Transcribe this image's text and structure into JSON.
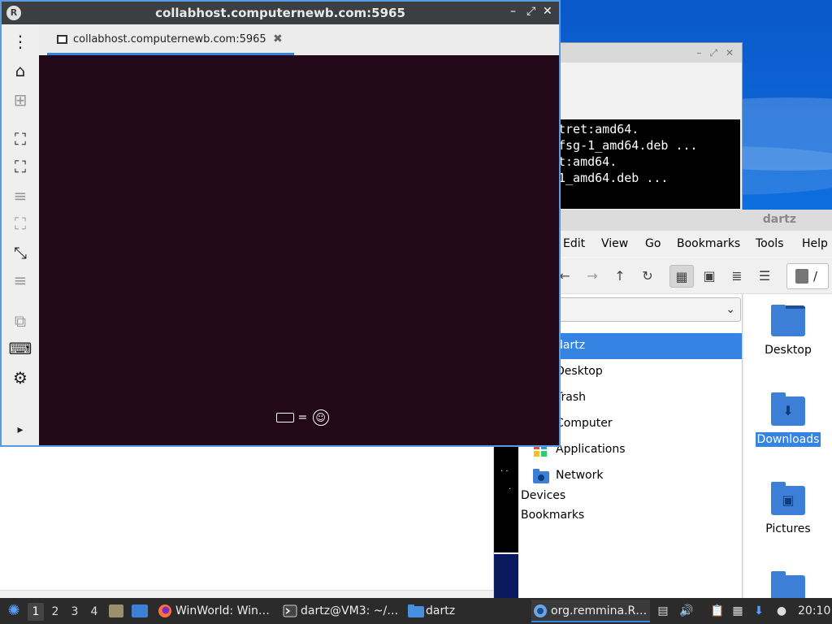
{
  "remmina": {
    "title": "collabhost.computernewb.com:5965",
    "tab_label": "collabhost.computernewb.com:5965",
    "tab_close": "✖",
    "controls": {
      "minimize": "–",
      "maximize": "⤢",
      "close": "✕"
    },
    "logo": "R",
    "sidebar": [
      "more-menu",
      "home",
      "new-connection",
      "fit-window",
      "fullscreen",
      "drag-handle",
      "dynamic-resolution",
      "scale",
      "drag-handle-2",
      "multi-monitor",
      "keyboard",
      "preferences",
      "expand"
    ],
    "sidebar_glyphs": [
      "⋮",
      "⌂",
      "⊞",
      "⛶",
      "⛶",
      "≡",
      "⛶",
      "⤡",
      "≡",
      "⧉",
      "⌨",
      "⚙",
      "▸"
    ],
    "indicator": {
      "eq": "=",
      "acc_glyph": "☺"
    }
  },
  "terminal": {
    "title_controls": [
      "–",
      "⤢",
      "✕"
    ],
    "lines": [
      "tret:amd64.",
      "fsg-1_amd64.deb ...",
      "",
      "t:amd64.",
      "1_amd64.deb ..."
    ]
  },
  "black_strip": {
    "dots_1": ". .",
    "dots_2": "."
  },
  "file_manager": {
    "title": "dartz",
    "menu": [
      "Edit",
      "View",
      "Go",
      "Bookmarks",
      "Tools",
      "Help"
    ],
    "toolbar": {
      "back": "←",
      "forward": "→",
      "up": "↑",
      "reload": "↻",
      "icon_view": "▦",
      "thumb_view": "▣",
      "compact_view": "≣",
      "list_view": "☰",
      "path": "/"
    },
    "select_chevron": "⌄",
    "places": [
      {
        "label": "dartz",
        "selected": true
      },
      {
        "label": "Desktop",
        "selected": false
      },
      {
        "label": "Trash",
        "selected": false
      },
      {
        "label": "Computer",
        "selected": false
      },
      {
        "label": "Applications",
        "selected": false
      },
      {
        "label": "Network",
        "selected": false
      }
    ],
    "sections": {
      "devices": "Devices",
      "bookmarks": "Bookmarks"
    },
    "icons": [
      {
        "label": "Desktop",
        "glyph": ""
      },
      {
        "label": "Downloads",
        "glyph": "⬇"
      },
      {
        "label": "Pictures",
        "glyph": "▣"
      },
      {
        "label": "",
        "glyph": ""
      }
    ]
  },
  "taskbar": {
    "start_glyph": "✺",
    "workspaces": [
      "1",
      "2",
      "3",
      "4"
    ],
    "tasks": [
      {
        "label": "WinWorld: Win…",
        "icon": "firefox-icon"
      },
      {
        "label": "dartz@VM3: ~/…",
        "icon": "terminal-icon"
      },
      {
        "label": "dartz",
        "icon": "folder-icon"
      },
      {
        "label": "org.remmina.R…",
        "icon": "remmina-icon"
      }
    ],
    "tray_glyphs": [
      "▤",
      "🔊",
      "📋",
      "▦",
      "⬇",
      "●"
    ],
    "clock": "20:10"
  },
  "colors": {
    "accent": "#3584e4",
    "remote_bg": "#220818",
    "titlebar": "#3c3f41",
    "taskbar": "#2b2b2b"
  }
}
